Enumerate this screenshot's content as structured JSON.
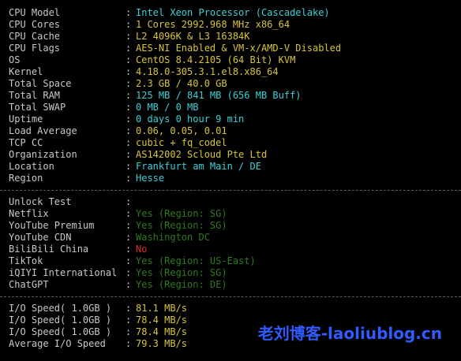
{
  "colors": {
    "label": "#c8c8c8",
    "cyan": "#3ccfd6",
    "yellow": "#d7c43a",
    "green_dark": "#2f7a1d",
    "red": "#d62c2c",
    "separator": "#5b5b5b",
    "watermark": "#2f5bff"
  },
  "system": [
    {
      "label": "CPU Model",
      "value": "Intel Xeon Processor (Cascadelake)",
      "color": "#3ccfd6"
    },
    {
      "label": "CPU Cores",
      "value": "1 Cores 2992.968 MHz x86_64",
      "color": "#d7c43a"
    },
    {
      "label": "CPU Cache",
      "value": "L2 4096K & L3 16384K",
      "color": "#d7c43a"
    },
    {
      "label": "CPU Flags",
      "value": "AES-NI Enabled & VM-x/AMD-V Disabled",
      "color": "#d7c43a"
    },
    {
      "label": "OS",
      "value": "CentOS 8.4.2105 (64 Bit) KVM",
      "color": "#d7c43a"
    },
    {
      "label": "Kernel",
      "value": "4.18.0-305.3.1.el8.x86_64",
      "color": "#d7c43a"
    },
    {
      "label": "Total Space",
      "value": "2.3 GB / 40.0 GB",
      "color": "#d7c43a"
    },
    {
      "label": "Total RAM",
      "value": "125 MB / 841 MB (656 MB Buff)",
      "color": "#3ccfd6"
    },
    {
      "label": "Total SWAP",
      "value": "0 MB / 0 MB",
      "color": "#3ccfd6"
    },
    {
      "label": "Uptime",
      "value": "0 days 0 hour 9 min",
      "color": "#3ccfd6"
    },
    {
      "label": "Load Average",
      "value": "0.06, 0.05, 0.01",
      "color": "#d7c43a"
    },
    {
      "label": "TCP CC",
      "value": "cubic + fq_codel",
      "color": "#d7c43a"
    },
    {
      "label": "Organization",
      "value": "AS142002 Scloud Pte Ltd",
      "color": "#d7c43a"
    },
    {
      "label": "Location",
      "value": "Frankfurt am Main / DE",
      "color": "#3ccfd6"
    },
    {
      "label": "Region",
      "value": "Hesse",
      "color": "#3ccfd6"
    }
  ],
  "unlock": [
    {
      "label": "Unlock Test",
      "value": "",
      "color": "#c8c8c8"
    },
    {
      "label": "Netflix",
      "value": "Yes (Region: SG)",
      "color": "#2f7a1d"
    },
    {
      "label": "YouTube Premium",
      "value": "Yes (Region: SG)",
      "color": "#2f7a1d"
    },
    {
      "label": "YouTube CDN",
      "value": "Washington DC",
      "color": "#2f7a1d"
    },
    {
      "label": "BiliBili China",
      "value": "No",
      "color": "#d62c2c"
    },
    {
      "label": "TikTok",
      "value": "Yes (Region: US-East)",
      "color": "#2f7a1d"
    },
    {
      "label": "iQIYI International",
      "value": "Yes (Region: SG)",
      "color": "#2f7a1d"
    },
    {
      "label": "ChatGPT",
      "value": "Yes (Region: DE)",
      "color": "#2f7a1d"
    }
  ],
  "io": [
    {
      "label": "I/O Speed( 1.0GB )",
      "value": "81.1 MB/s",
      "color": "#d7c43a"
    },
    {
      "label": "I/O Speed( 1.0GB )",
      "value": "78.4 MB/s",
      "color": "#d7c43a"
    },
    {
      "label": "I/O Speed( 1.0GB )",
      "value": "78.4 MB/s",
      "color": "#d7c43a"
    },
    {
      "label": "Average I/O Speed",
      "value": "79.3 MB/s",
      "color": "#d7c43a"
    }
  ],
  "colon": ":",
  "watermark": "老刘博客-laoliublog.cn"
}
